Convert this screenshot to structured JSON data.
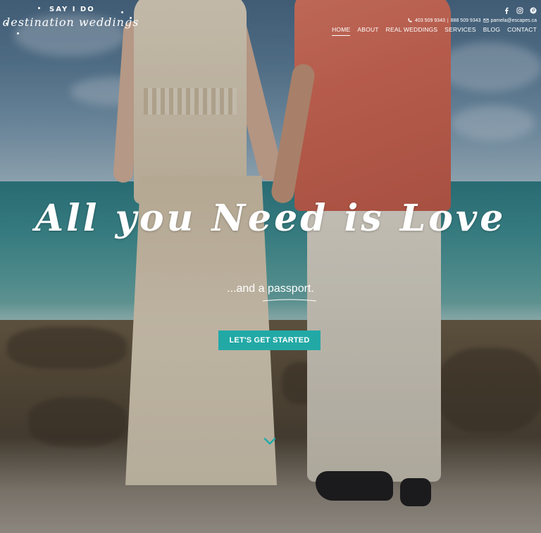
{
  "logo": {
    "top_text": "SAY I DO",
    "script_text": "destination weddings"
  },
  "social": {
    "icons": [
      "facebook-icon",
      "instagram-icon",
      "pinterest-icon"
    ],
    "labels": [
      "f",
      "◎",
      "P"
    ]
  },
  "contact": {
    "phone_icon": "phone-icon",
    "phone_1": "403 509 9343",
    "separator": "|",
    "phone_2": "888 509 9343",
    "email_icon": "envelope-icon",
    "email": "pamela@escapes.ca"
  },
  "nav": {
    "items": [
      {
        "label": "HOME",
        "active": true
      },
      {
        "label": "ABOUT"
      },
      {
        "label": "REAL WEDDINGS"
      },
      {
        "label": "SERVICES"
      },
      {
        "label": "BLOG"
      },
      {
        "label": "CONTACT"
      }
    ]
  },
  "hero": {
    "headline": "All you Need is Love",
    "tagline": "...and a passport.",
    "cta_label": "LET'S GET STARTED",
    "scroll_icon": "chevron-down-icon"
  },
  "colors": {
    "accent": "#22a9a6",
    "text": "#ffffff"
  }
}
